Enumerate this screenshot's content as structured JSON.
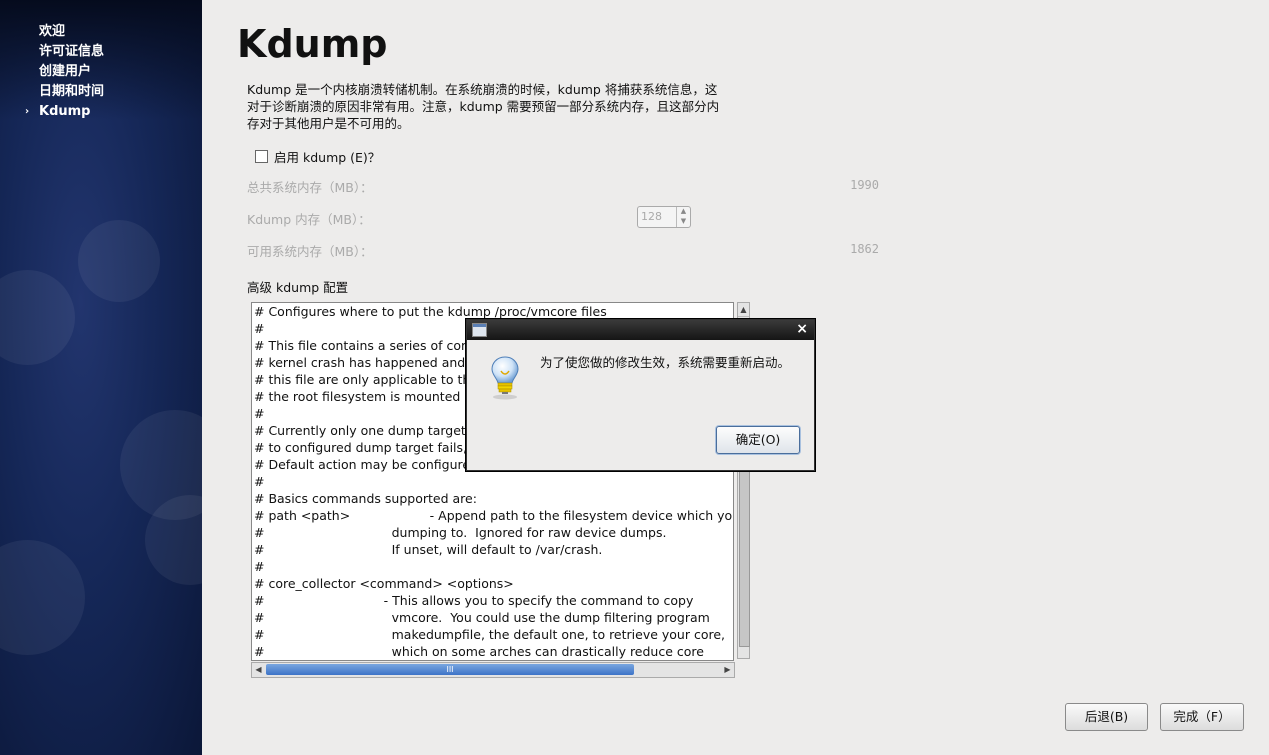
{
  "sidebar": {
    "items": [
      {
        "label": "欢迎"
      },
      {
        "label": "许可证信息"
      },
      {
        "label": "创建用户"
      },
      {
        "label": "日期和时间"
      },
      {
        "label": "Kdump",
        "current": true
      }
    ]
  },
  "main": {
    "title": "Kdump",
    "description": [
      "Kdump 是一个内核崩溃转储机制。在系统崩溃的时候，kdump 将捕获系统信息，这",
      "对于诊断崩溃的原因非常有用。注意，kdump 需要预留一部分系统内存，且这部分内",
      "存对于其他用户是不可用的。"
    ],
    "enable_label": "启用 kdump (E)？",
    "enable_checked": false,
    "total_mem_label": "总共系统内存（MB）：",
    "total_mem_value": "1990",
    "kdump_mem_label": "Kdump 内存（MB）：",
    "kdump_mem_value": "128",
    "avail_mem_label": "可用系统内存（MB）：",
    "avail_mem_value": "1862",
    "advanced_label": "高级 kdump 配置",
    "config_text": "# Configures where to put the kdump /proc/vmcore files\n#\n# This file contains a series of commands to perform (in order) when a\n# kernel crash has happened and the kdump kernel has been loaded.  Directives in\n# this file are only applicable to the kdump initramfs, and have no effect if\n# the root filesystem is mounted and the normal init scripts are processed\n#\n# Currently only one dump target and path may be configured at once\n# to configured dump target fails, the default action will be preformed\n# Default action may be configured with the \"default\" directive below.\n#\n# Basics commands supported are:\n# path <path>                    - Append path to the filesystem device which you are\n#                                dumping to.  Ignored for raw device dumps.\n#                                If unset, will default to /var/crash.\n#\n# core_collector <command> <options>\n#                              - This allows you to specify the command to copy\n#                                vmcore.  You could use the dump filtering program\n#                                makedumpfile, the default one, to retrieve your core,\n#                                which on some arches can drastically reduce core\n#                                size. See /usr/sbin/makedumpfile --help for a list of"
  },
  "footer": {
    "back_label": "后退(B)",
    "finish_label": "完成（F）"
  },
  "dialog": {
    "message": "为了使您做的修改生效，系统需要重新启动。",
    "ok_label": "确定(O)",
    "close_icon": "×",
    "icon": "lightbulb-icon"
  },
  "scrollbar": {
    "thumb_grip": "III"
  }
}
